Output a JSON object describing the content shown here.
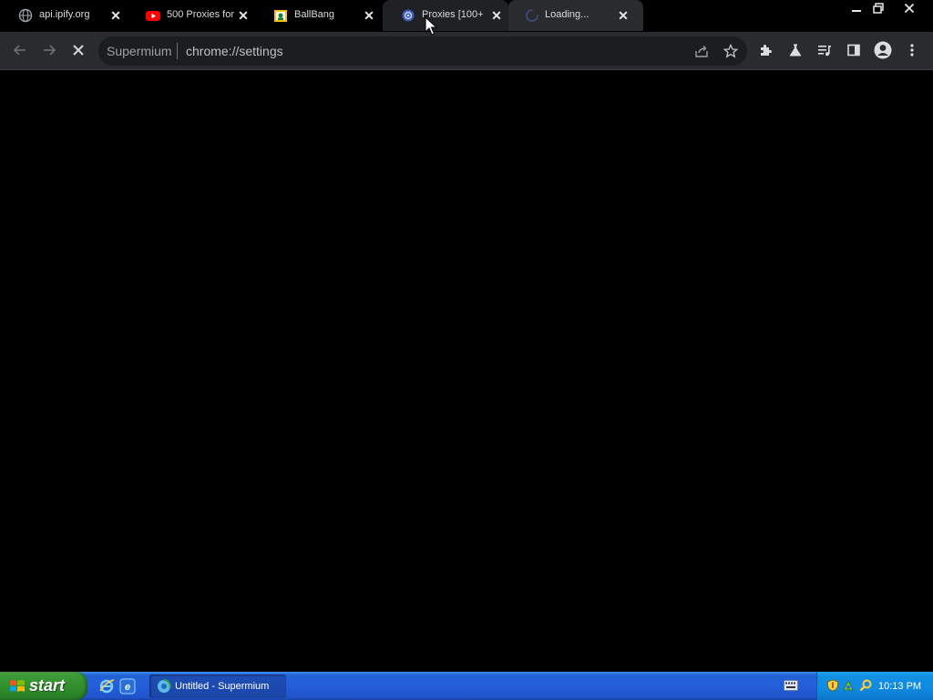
{
  "tabs": [
    {
      "title": "api.ipify.org",
      "icon": "globe-icon"
    },
    {
      "title": "500 Proxies for",
      "icon": "youtube-icon"
    },
    {
      "title": "BallBang",
      "icon": "ballbang-icon"
    },
    {
      "title": "Proxies [100+",
      "icon": "proxies-icon"
    },
    {
      "title": "Loading...",
      "icon": "loading-spinner-icon"
    }
  ],
  "window_controls": [
    "minimize",
    "restore",
    "close"
  ],
  "omnibox": {
    "site": "Supermium",
    "url": "chrome://settings"
  },
  "toolbar_icons": [
    "back-arrow-icon",
    "forward-arrow-icon",
    "stop-icon",
    "share-icon",
    "bookmark-star-icon",
    "extensions-puzzle-icon",
    "labs-flask-icon",
    "media-queue-icon",
    "side-panel-icon",
    "profile-avatar-icon",
    "menu-kebab-icon"
  ],
  "taskbar": {
    "start_label": "start",
    "task_item_label": "Untitled - Supermium",
    "clock": "10:13 PM"
  },
  "colors": {
    "toolbar_bg": "#2a2b2e",
    "page_bg": "#000000",
    "taskbar_blue": "#245edb",
    "start_green": "#3c9a38",
    "tray_blue": "#0f8ae0"
  }
}
